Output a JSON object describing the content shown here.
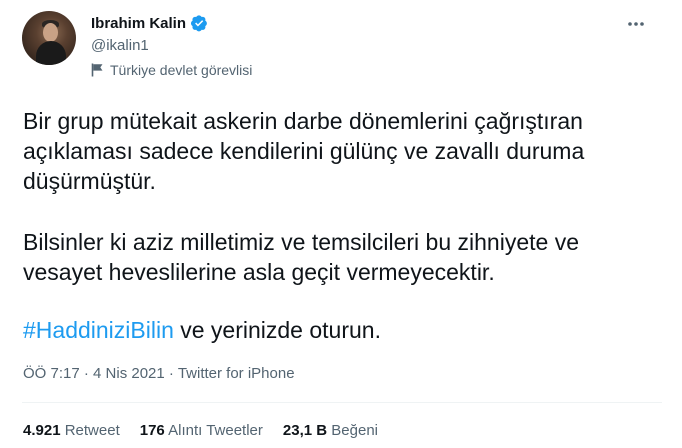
{
  "user": {
    "name": "Ibrahim Kalin",
    "handle": "@ikalin1",
    "label": "Türkiye devlet görevlisi"
  },
  "tweet": {
    "paragraph1": "Bir grup mütekait askerin darbe dönemlerini çağrıştıran açıklaması sadece kendilerini gülünç ve zavallı duruma düşürmüştür.",
    "paragraph2": "Bilsinler ki aziz milletimiz ve temsilcileri bu zihniyete ve vesayet heveslilerine asla geçit vermeyecektir.",
    "hashtag": "#HaddiniziBilin",
    "paragraph3_rest": " ve yerinizde oturun.",
    "timestamp": "ÖÖ 7:17 · 4 Nis 2021 · ",
    "source": "Twitter for iPhone"
  },
  "stats": {
    "retweets_count": "4.921",
    "retweets_label": "Retweet",
    "quotes_count": "176",
    "quotes_label": "Alıntı Tweetler",
    "likes_count": "23,1 B",
    "likes_label": "Beğeni"
  },
  "colors": {
    "accent": "#1d9bf0",
    "secondary_text": "#536471"
  },
  "icons": {
    "verified": "verified-badge-icon",
    "more": "more-horizontal-icon",
    "label": "flag-icon"
  }
}
